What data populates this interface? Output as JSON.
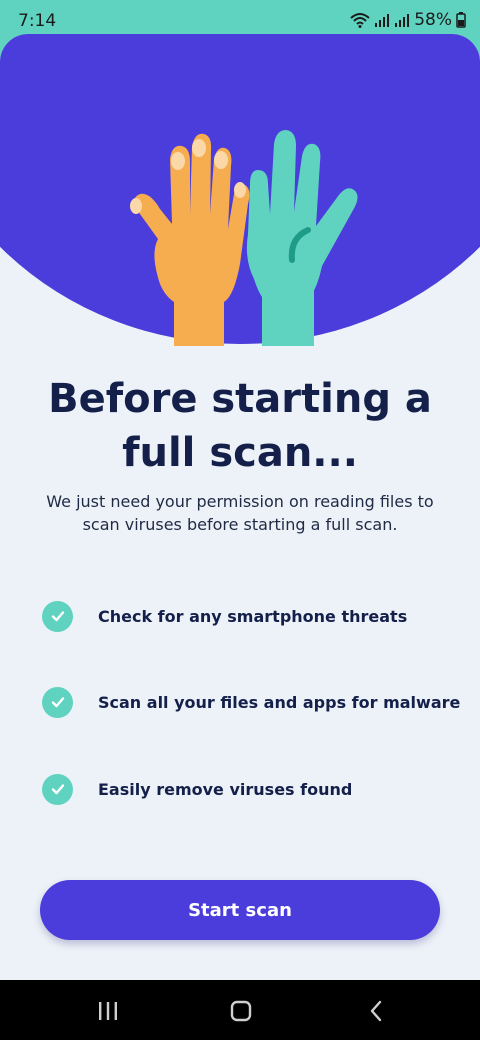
{
  "status_bar": {
    "time": "7:14",
    "battery": "58%",
    "icons": [
      "wifi-icon",
      "signal-icon",
      "signal-icon",
      "battery-icon"
    ]
  },
  "colors": {
    "hero": "#4b3cdc",
    "teal": "#5fd3c0",
    "orange": "#f5ad4f",
    "title": "#14204a",
    "button": "#4b3cdc"
  },
  "hero": {
    "illustration": "raised-hands"
  },
  "title": "Before starting a full scan...",
  "subtitle": "We just need your permission on reading files to scan viruses before starting a full scan.",
  "features": [
    {
      "label": "Check for any smartphone threats",
      "icon": "check-icon"
    },
    {
      "label": "Scan all your files and apps for malware",
      "icon": "check-icon"
    },
    {
      "label": "Easily remove viruses found",
      "icon": "check-icon"
    }
  ],
  "cta": {
    "label": "Start scan"
  },
  "nav_bar": {
    "buttons": [
      "recents-icon",
      "home-icon",
      "back-icon"
    ]
  }
}
